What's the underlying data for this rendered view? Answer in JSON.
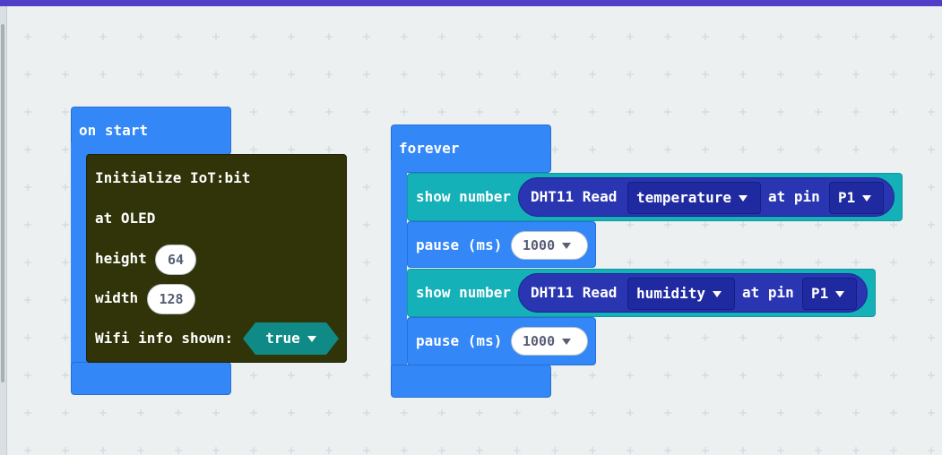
{
  "colors": {
    "top_bar": "#4f3fc7",
    "workspace_bg": "#ecf0f1",
    "basic_blue": "#3387f6",
    "iot_olive": "#303408",
    "show_number_teal": "#14b1b8",
    "dht11_navy": "#2a35b1",
    "bool_teal": "#0f8a86"
  },
  "on_start": {
    "label": "on start",
    "init_block": {
      "title": "Initialize IoT:bit",
      "at_label": "at OLED",
      "height_label": "height",
      "height_value": "64",
      "width_label": "width",
      "width_value": "128",
      "wifi_label": "Wifi info shown:",
      "wifi_value": "true"
    }
  },
  "forever": {
    "label": "forever",
    "show1": {
      "label": "show number",
      "reporter": "DHT11 Read",
      "sensor": "temperature",
      "pin_label": "at pin",
      "pin": "P1"
    },
    "pause1": {
      "label": "pause (ms)",
      "value": "1000"
    },
    "show2": {
      "label": "show number",
      "reporter": "DHT11 Read",
      "sensor": "humidity",
      "pin_label": "at pin",
      "pin": "P1"
    },
    "pause2": {
      "label": "pause (ms)",
      "value": "1000"
    }
  }
}
